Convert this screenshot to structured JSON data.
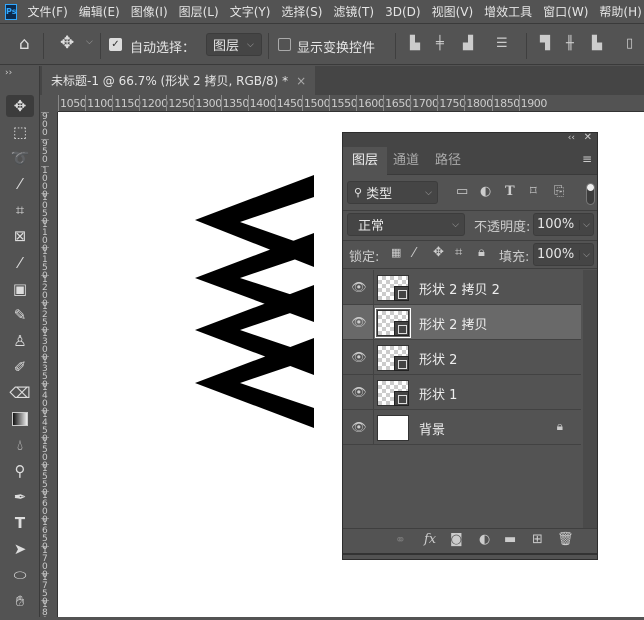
{
  "app": {
    "logo": "Ps"
  },
  "menu": [
    "文件(F)",
    "编辑(E)",
    "图像(I)",
    "图层(L)",
    "文字(Y)",
    "选择(S)",
    "滤镜(T)",
    "3D(D)",
    "视图(V)",
    "增效工具",
    "窗口(W)",
    "帮助(H)"
  ],
  "options": {
    "auto_select_label": "自动选择：",
    "auto_select_checked": true,
    "auto_select_target": "图层",
    "show_transform_label": "显示变换控件",
    "show_transform_checked": false
  },
  "document_tab": {
    "title": "未标题-1 @ 66.7% (形状 2 拷贝, RGB/8) *",
    "close": "×"
  },
  "ruler_top": [
    "1050",
    "1100",
    "1150",
    "1200",
    "1250",
    "1300",
    "1350",
    "1400",
    "1450",
    "1500",
    "1550",
    "1600",
    "1650",
    "1700",
    "1750",
    "1800",
    "1850",
    "1900"
  ],
  "ruler_left": [
    "900",
    "950",
    "1000",
    "1050",
    "1100",
    "1150",
    "1200",
    "1250",
    "1300",
    "1350",
    "1400",
    "1450",
    "1500",
    "1550",
    "1600",
    "1650",
    "1700",
    "1750",
    "1800"
  ],
  "layers_panel": {
    "tabs": [
      "图层",
      "通道",
      "路径"
    ],
    "active_tab": 0,
    "filter": "类型",
    "blend_mode": "正常",
    "opacity_label": "不透明度:",
    "opacity": "100%",
    "lock_label": "锁定:",
    "fill_label": "填充:",
    "fill": "100%",
    "layers": [
      {
        "name": "形状 2 拷贝 2",
        "type": "shape",
        "selected": false
      },
      {
        "name": "形状 2 拷贝",
        "type": "shape",
        "selected": true
      },
      {
        "name": "形状 2",
        "type": "shape",
        "selected": false
      },
      {
        "name": "形状 1",
        "type": "shape",
        "selected": false
      },
      {
        "name": "背景",
        "type": "background",
        "selected": false,
        "locked": true
      }
    ]
  }
}
